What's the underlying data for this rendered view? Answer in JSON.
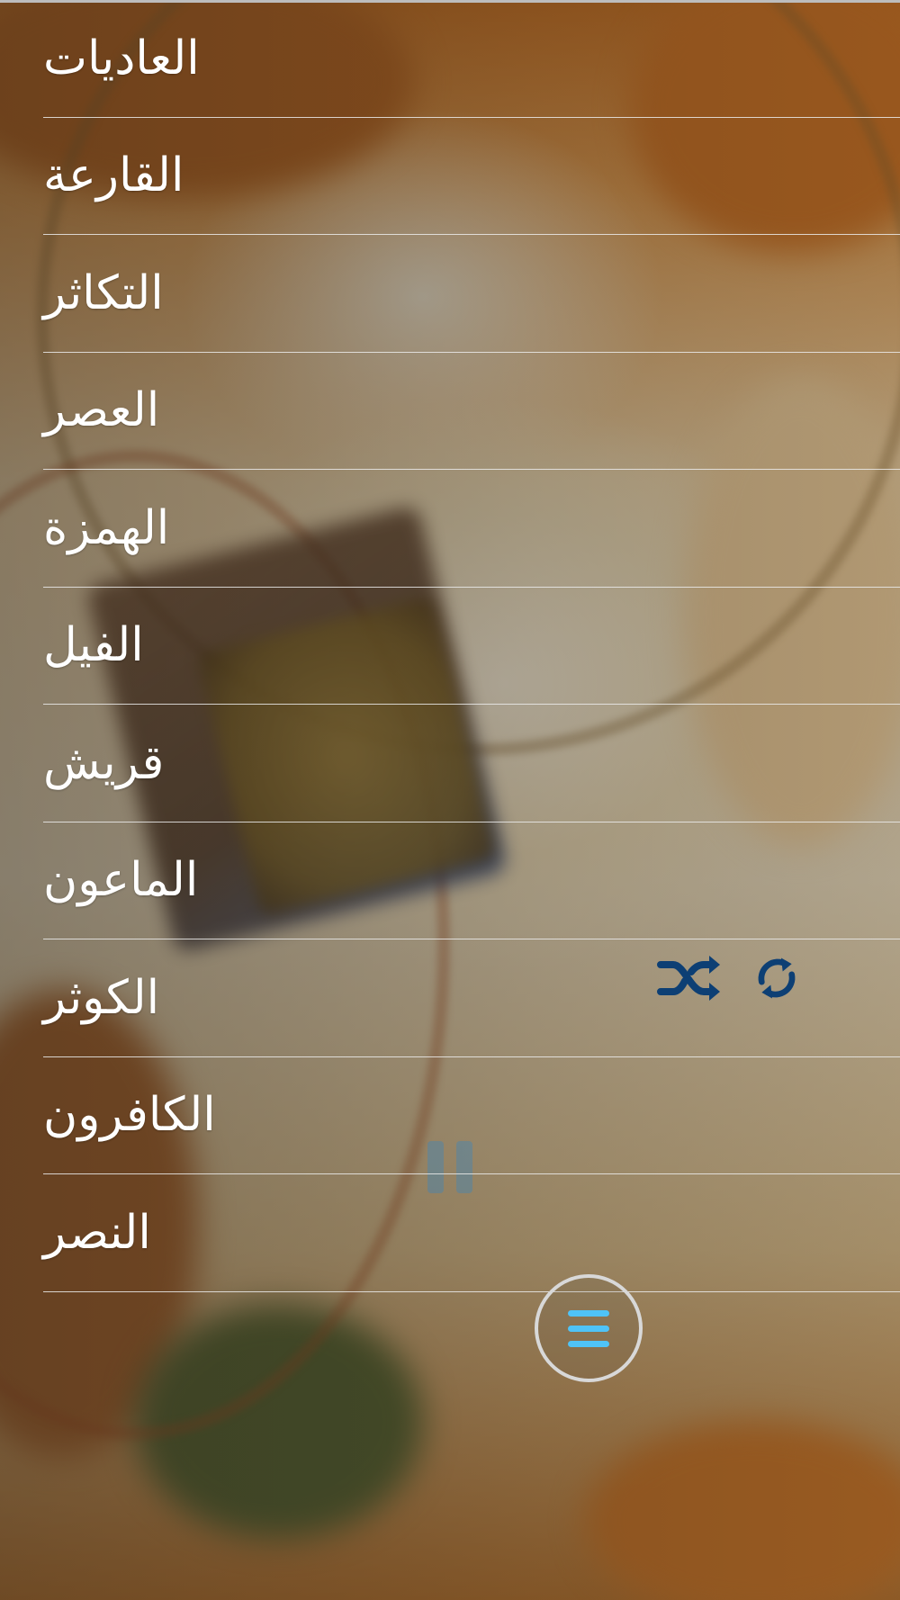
{
  "surah_list": {
    "items": [
      {
        "label": "العاديات"
      },
      {
        "label": "القارعة"
      },
      {
        "label": "التكاثر"
      },
      {
        "label": "العصر"
      },
      {
        "label": "الهمزة"
      },
      {
        "label": "الفيل"
      },
      {
        "label": "قريش"
      },
      {
        "label": "الماعون"
      },
      {
        "label": "الكوثر"
      },
      {
        "label": "الكافرون"
      },
      {
        "label": "النصر"
      }
    ]
  },
  "player_controls": {
    "shuffle_icon": "shuffle-icon",
    "repeat_icon": "repeat-icon",
    "icon_color": "#0d3f74"
  },
  "menu_button": {
    "icon": "hamburger-menu-icon",
    "icon_color": "#4fc3f7",
    "ring_color": "#d8d8d8"
  }
}
